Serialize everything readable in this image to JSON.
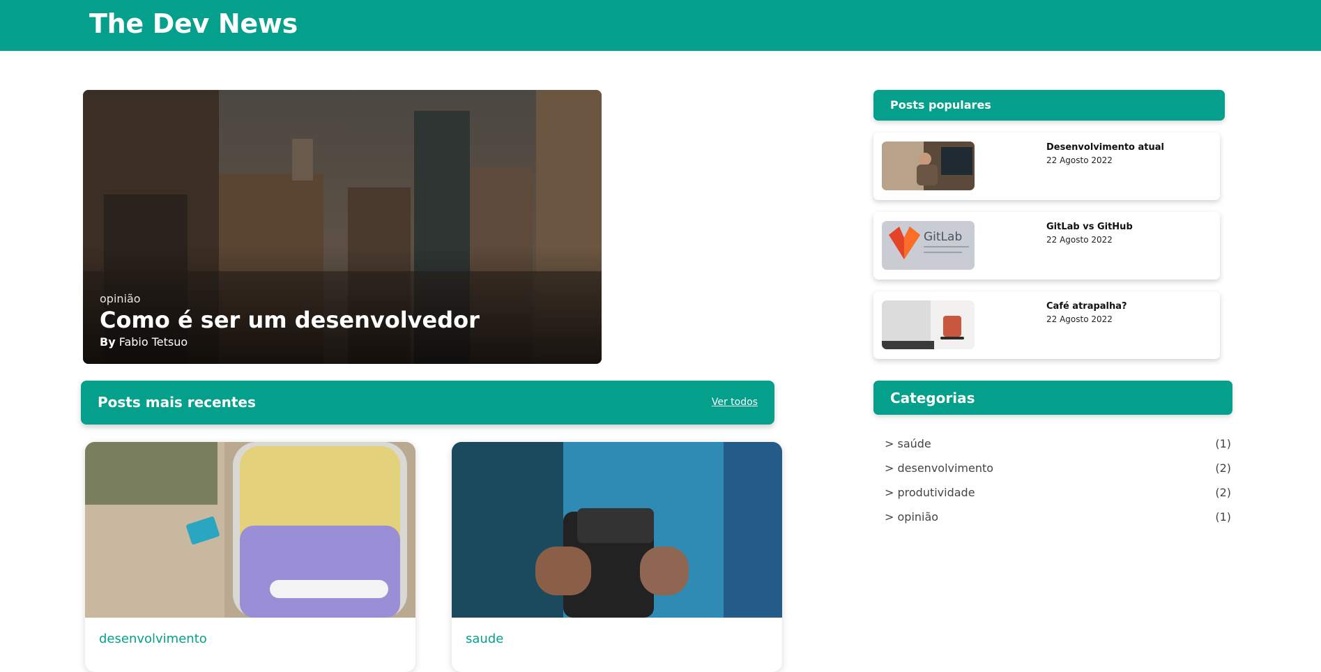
{
  "header": {
    "brand": "The Dev News"
  },
  "hero": {
    "category": "opinião",
    "title": "Como é ser um desenvolvedor",
    "by_label": "By",
    "author": "Fabio Tetsuo"
  },
  "recent": {
    "title": "Posts mais recentes",
    "see_all": "Ver todos",
    "posts": [
      {
        "category": "desenvolvimento"
      },
      {
        "category": "saude"
      }
    ]
  },
  "popular": {
    "title": "Posts populares",
    "items": [
      {
        "title": "Desenvolvimento atual",
        "date": "22 Agosto 2022"
      },
      {
        "title": "GitLab vs GitHub",
        "date": "22 Agosto 2022"
      },
      {
        "title": "Café atrapalha?",
        "date": "22 Agosto 2022"
      }
    ]
  },
  "categories": {
    "title": "Categorias",
    "items": [
      {
        "name": "> saúde",
        "count": "(1)"
      },
      {
        "name": "> desenvolvimento",
        "count": "(2)"
      },
      {
        "name": "> produtividade",
        "count": "(2)"
      },
      {
        "name": "> opinião",
        "count": "(1)"
      }
    ]
  },
  "colors": {
    "brand": "#04a08b",
    "background": "#ffffff"
  }
}
